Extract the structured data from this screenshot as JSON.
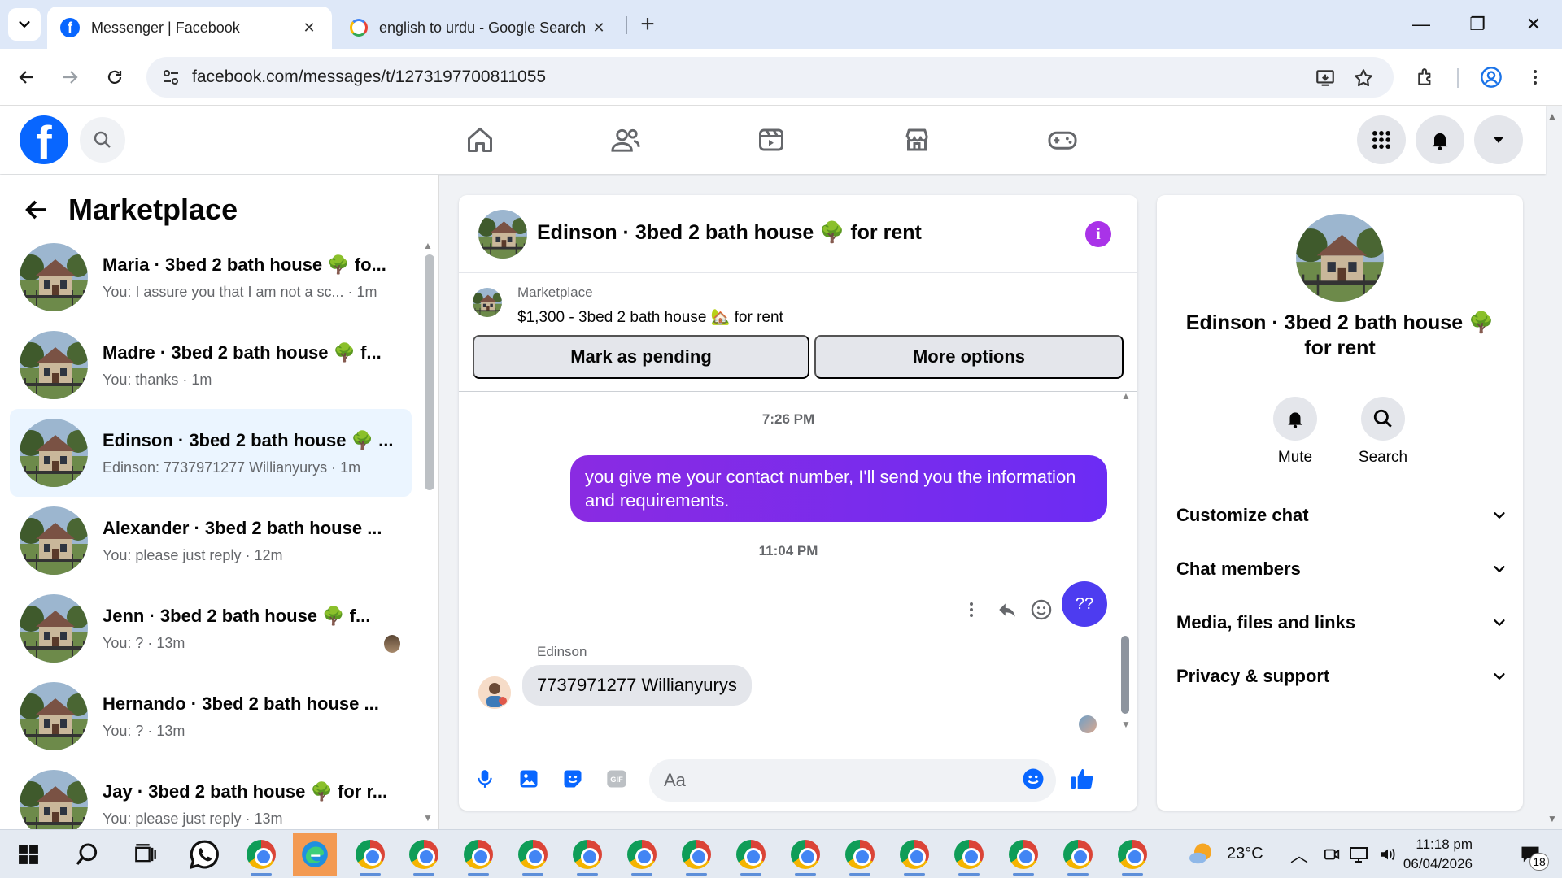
{
  "browser": {
    "tabs": [
      {
        "title": "Messenger | Facebook",
        "active": true
      },
      {
        "title": "english to urdu - Google Search",
        "active": false
      }
    ],
    "url": "facebook.com/messages/t/1273197700811055"
  },
  "left": {
    "title": "Marketplace",
    "conversations": [
      {
        "name": "Maria · 3bed 2 bath house 🌳 fo...",
        "preview": "You: I assure you that I am not a sc... · 1m"
      },
      {
        "name": "Madre · 3bed 2 bath house 🌳 f...",
        "preview": "You: thanks · 1m"
      },
      {
        "name": "Edinson · 3bed 2 bath house 🌳 ...",
        "preview": "Edinson: 7737971277 Willianyurys · 1m"
      },
      {
        "name": "Alexander · 3bed 2 bath house ...",
        "preview": "You: please just reply · 12m"
      },
      {
        "name": "Jenn · 3bed 2 bath house 🌳 f...",
        "preview": "You: ? · 13m"
      },
      {
        "name": "Hernando · 3bed 2 bath house ...",
        "preview": "You: ? · 13m"
      },
      {
        "name": "Jay · 3bed 2 bath house 🌳 for r...",
        "preview": "You: please just reply · 13m"
      }
    ]
  },
  "chat": {
    "title": "Edinson · 3bed 2 bath house 🌳 for rent",
    "listing_label": "Marketplace",
    "listing_price": "$1,300 - 3bed 2 bath house 🏡 for rent",
    "mark_pending": "Mark as pending",
    "more_options": "More options",
    "time1": "7:26 PM",
    "outgoing": "you give me your contact number, I'll send you the information and requirements.",
    "time2": "11:04 PM",
    "pending_bubble": "??",
    "sender": "Edinson",
    "incoming": "7737971277 Willianyurys",
    "composer_placeholder": "Aa"
  },
  "right": {
    "name": "Edinson · 3bed 2 bath house 🌳 for rent",
    "mute": "Mute",
    "search": "Search",
    "sections": [
      "Customize chat",
      "Chat members",
      "Media, files and links",
      "Privacy & support"
    ]
  },
  "taskbar": {
    "weather": "23°C",
    "time": "11:18 pm",
    "date": "06/04/2026",
    "notifications": "18"
  },
  "colors": {
    "fb_blue": "#0866ff",
    "messenger_purple": "#7a26f4",
    "selected_row": "#ebf5ff"
  }
}
